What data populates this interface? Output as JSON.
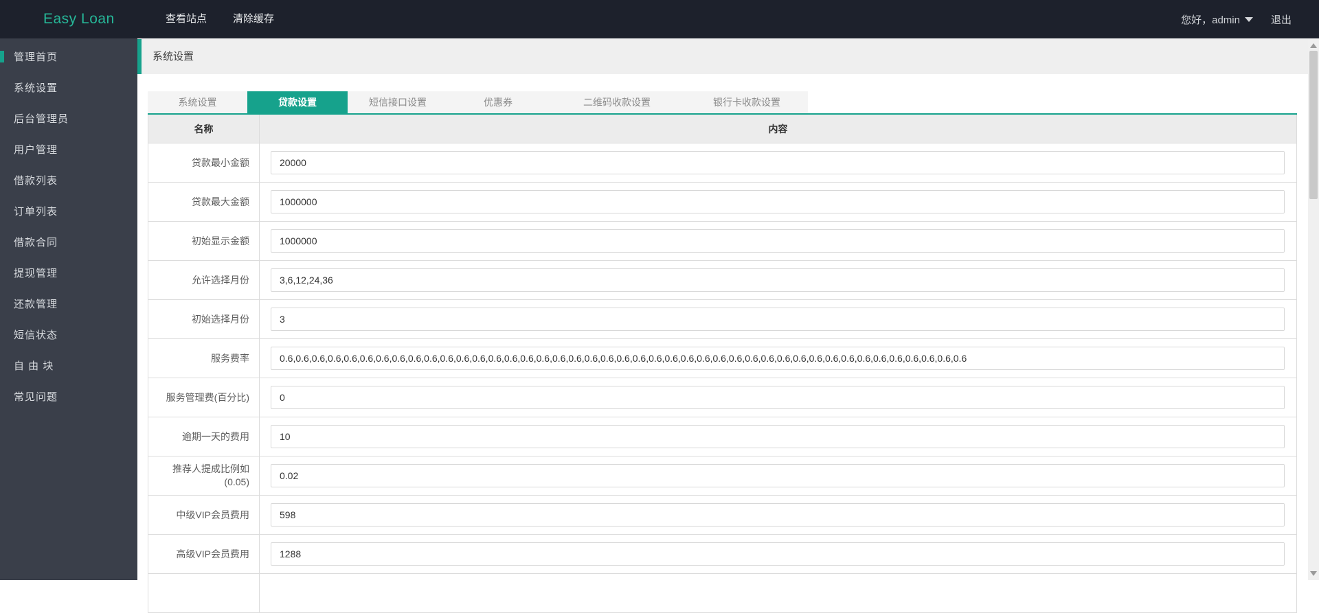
{
  "colors": {
    "topbar_bg": "#1d212c",
    "sidebar_bg": "#3a3f4a",
    "accent_teal": "#16a28c",
    "logo_teal": "#26b798",
    "breadcrumb_bg": "#efefef",
    "table_header_bg": "#ececec"
  },
  "topbar": {
    "logo": "Easy Loan",
    "menu": [
      {
        "label": "查看站点"
      },
      {
        "label": "清除缓存"
      }
    ],
    "greeting": "您好，admin",
    "logout": "退出"
  },
  "sidebar": {
    "items": [
      {
        "label": "管理首页",
        "active": true
      },
      {
        "label": "系统设置",
        "active": false
      },
      {
        "label": "后台管理员",
        "active": false
      },
      {
        "label": "用户管理",
        "active": false
      },
      {
        "label": "借款列表",
        "active": false
      },
      {
        "label": "订单列表",
        "active": false
      },
      {
        "label": "借款合同",
        "active": false
      },
      {
        "label": "提现管理",
        "active": false
      },
      {
        "label": "还款管理",
        "active": false
      },
      {
        "label": "短信状态",
        "active": false
      },
      {
        "label": "自 由 块",
        "active": false
      },
      {
        "label": "常见问题",
        "active": false
      }
    ]
  },
  "breadcrumb": {
    "title": "系统设置"
  },
  "tabs": [
    {
      "label": "系统设置",
      "active": false
    },
    {
      "label": "贷款设置",
      "active": true
    },
    {
      "label": "短信接口设置",
      "active": false
    },
    {
      "label": "优惠券",
      "active": false
    },
    {
      "label": "二维码收款设置",
      "active": false
    },
    {
      "label": "银行卡收款设置",
      "active": false
    }
  ],
  "table": {
    "headers": {
      "name": "名称",
      "content": "内容"
    },
    "rows": [
      {
        "label": "贷款最小金额",
        "value": "20000"
      },
      {
        "label": "贷款最大金额",
        "value": "1000000"
      },
      {
        "label": "初始显示金额",
        "value": "1000000"
      },
      {
        "label": "允许选择月份",
        "value": "3,6,12,24,36"
      },
      {
        "label": "初始选择月份",
        "value": "3"
      },
      {
        "label": "服务费率",
        "value": "0.6,0.6,0.6,0.6,0.6,0.6,0.6,0.6,0.6,0.6,0.6,0.6,0.6,0.6,0.6,0.6,0.6,0.6,0.6,0.6,0.6,0.6,0.6,0.6,0.6,0.6,0.6,0.6,0.6,0.6,0.6,0.6,0.6,0.6,0.6,0.6,0.6,0.6,0.6,0.6,0.6,0.6,0.6"
      },
      {
        "label": "服务管理费(百分比)",
        "value": "0"
      },
      {
        "label": "逾期一天的费用",
        "value": "10"
      },
      {
        "label": "推荐人提成比例如",
        "label2": "(0.05)",
        "value": "0.02"
      },
      {
        "label": "中级VIP会员费用",
        "value": "598"
      },
      {
        "label": "高级VIP会员费用",
        "value": "1288"
      },
      {
        "label": "",
        "value": ""
      }
    ]
  }
}
